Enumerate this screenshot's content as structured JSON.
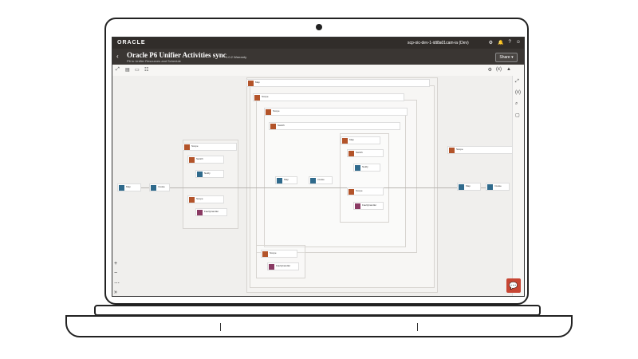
{
  "header": {
    "logo": "ORACLE",
    "environment": "scp-oic-dev-1-idt8a01cam-ia (Dev)",
    "top_icons": [
      "gear-icon",
      "bell-icon",
      "help-icon",
      "user-icon"
    ]
  },
  "titlebar": {
    "back": "‹",
    "title": "Oracle P6 Unifier Activities sync",
    "subtitle": "P6 to Unifier Resources and Schedule",
    "version": "1.0.2 Warranty",
    "share_label": "Share ▾"
  },
  "toolbar": {
    "icons": [
      "expand-icon",
      "layout-icon",
      "rows-icon",
      "tree-icon"
    ],
    "right_icons": [
      "gear-icon",
      "code-icon",
      "warning-icon"
    ]
  },
  "canvas": {
    "nodes": [
      {
        "label": "Map",
        "sub": "Map to Invoke1",
        "color": "orange"
      },
      {
        "label": "Scope",
        "sub": "ScopeInvoke",
        "color": "orange"
      },
      {
        "label": "Scope",
        "sub": "",
        "color": "orange"
      },
      {
        "label": "Switch",
        "sub": "",
        "color": "orange"
      },
      {
        "label": "Notify",
        "sub": "Notification",
        "color": "blue"
      },
      {
        "label": "Faultyhandler",
        "sub": "Fault",
        "color": "purple"
      },
      {
        "label": "Scope",
        "sub": "",
        "color": "orange"
      },
      {
        "label": "Map",
        "sub": "",
        "color": "blue"
      },
      {
        "label": "Invoke",
        "sub": "",
        "color": "blue"
      },
      {
        "label": "Switch",
        "sub": "",
        "color": "orange"
      },
      {
        "label": "Notify",
        "sub": "",
        "color": "blue"
      },
      {
        "label": "Faultyhandler",
        "sub": "",
        "color": "purple"
      },
      {
        "label": "Scope",
        "sub": "",
        "color": "orange"
      },
      {
        "label": "Map",
        "sub": "",
        "color": "blue"
      },
      {
        "label": "Invoke",
        "sub": "",
        "color": "blue"
      }
    ]
  },
  "zoom": {
    "in": "+",
    "out": "−",
    "more": "⋯",
    "collapse": "»"
  },
  "rail": [
    "settings-icon",
    "variable-icon",
    "search-icon",
    "document-icon"
  ],
  "chat_label": "💬"
}
